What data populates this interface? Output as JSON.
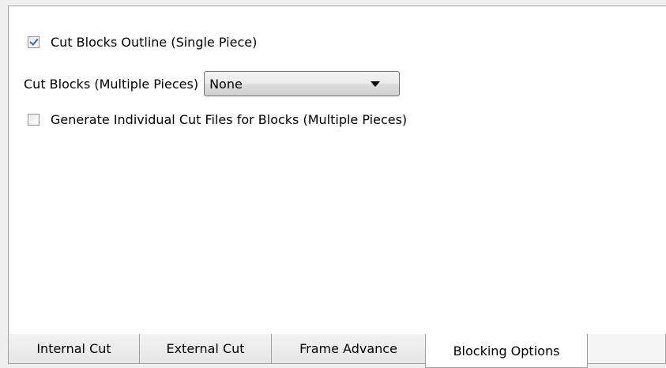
{
  "options": {
    "cut_blocks_outline": {
      "label": "Cut Blocks Outline (Single Piece)",
      "checked": true
    },
    "cut_blocks_multiple": {
      "label": "Cut Blocks (Multiple Pieces)",
      "selected": "None"
    },
    "individual_cut_files": {
      "label": "Generate Individual Cut Files for Blocks (Multiple Pieces)",
      "checked": false
    }
  },
  "tabs": [
    {
      "label": "Internal Cut",
      "active": false
    },
    {
      "label": "External Cut",
      "active": false
    },
    {
      "label": "Frame Advance",
      "active": false
    },
    {
      "label": "Blocking Options",
      "active": true
    }
  ],
  "colors": {
    "panel_background": "#ffffff",
    "window_background": "#f0f0f0",
    "border": "#a0a0a0",
    "check_mark": "#3c5fa8"
  }
}
